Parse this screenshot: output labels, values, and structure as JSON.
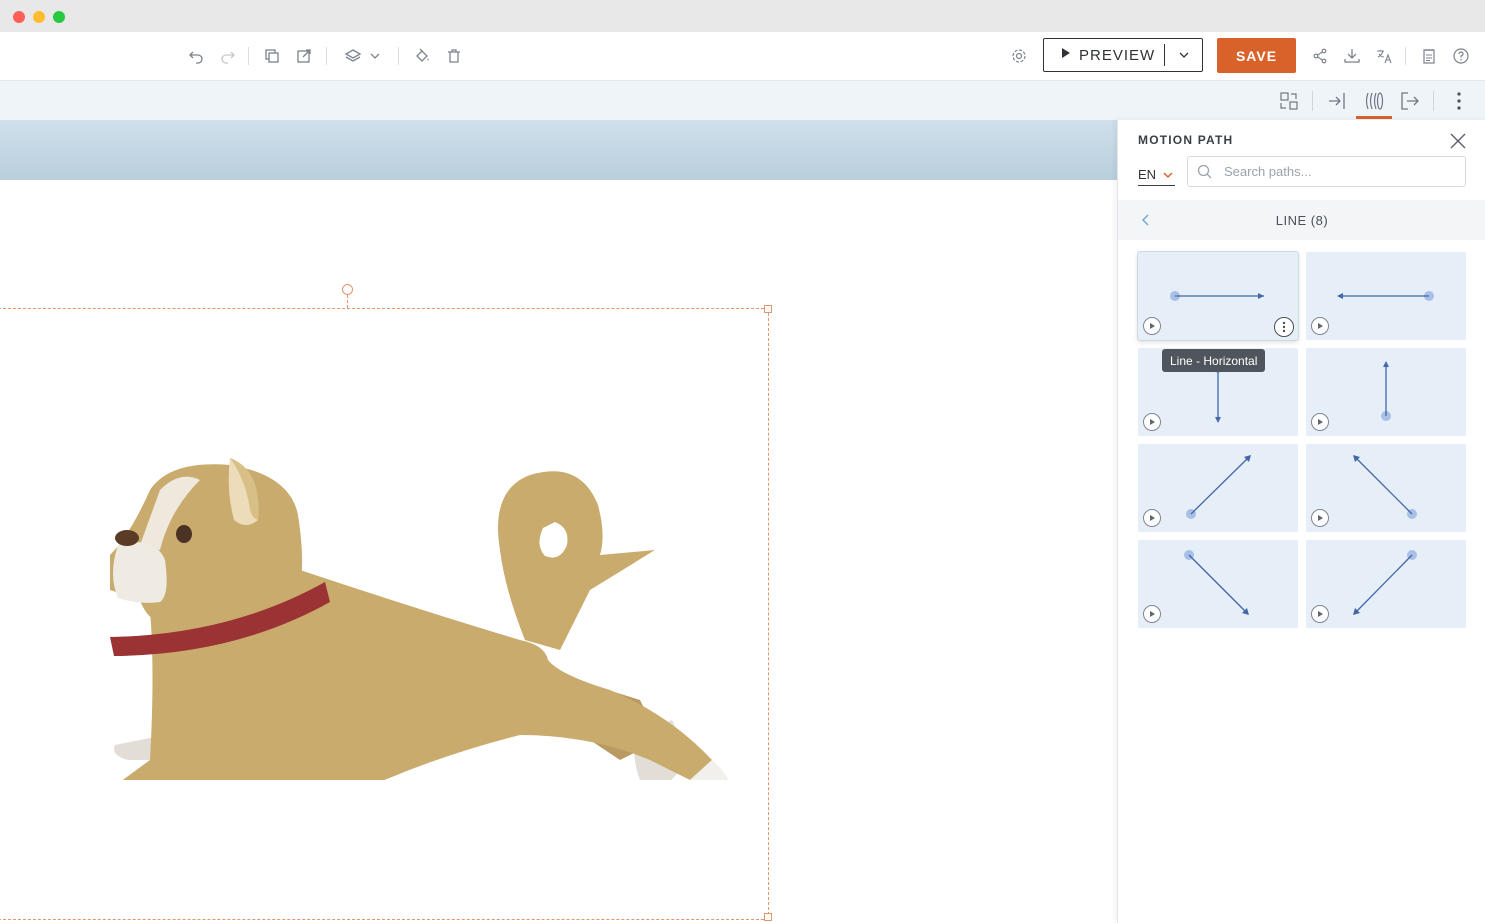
{
  "window": {
    "traffic_lights": [
      "#ff5f57",
      "#febc2e",
      "#28c840"
    ]
  },
  "toolbar": {
    "left_icons": [
      "undo-icon",
      "redo-icon",
      "copy-icon",
      "duplicate-icon",
      "layers-icon",
      "chevron-down-icon",
      "paint-bucket-icon",
      "trash-icon"
    ],
    "preview_label": "PREVIEW",
    "save_label": "SAVE",
    "right_icons": [
      "gear-icon",
      "share-icon",
      "download-icon",
      "translate-icon",
      "notes-icon",
      "help-icon"
    ],
    "accent": "#d9622b"
  },
  "subtoolbar": {
    "icons": [
      "replace-icon",
      "entrance-icon",
      "motion-path-icon",
      "exit-icon",
      "more-vertical-icon"
    ],
    "active": "motion-path-icon"
  },
  "panel": {
    "title": "MOTION PATH",
    "language": "EN",
    "search_placeholder": "Search paths...",
    "category_title": "LINE (8)",
    "tooltip": "Line - Horizontal",
    "tiles": [
      {
        "name": "line-horizontal-right",
        "selected": true
      },
      {
        "name": "line-horizontal-left",
        "selected": false
      },
      {
        "name": "line-vertical-down",
        "selected": false
      },
      {
        "name": "line-vertical-up",
        "selected": false
      },
      {
        "name": "line-diagonal-up-right",
        "selected": false
      },
      {
        "name": "line-diagonal-up-left",
        "selected": false
      },
      {
        "name": "line-diagonal-down-right",
        "selected": false
      },
      {
        "name": "line-diagonal-down-left",
        "selected": false
      }
    ]
  }
}
